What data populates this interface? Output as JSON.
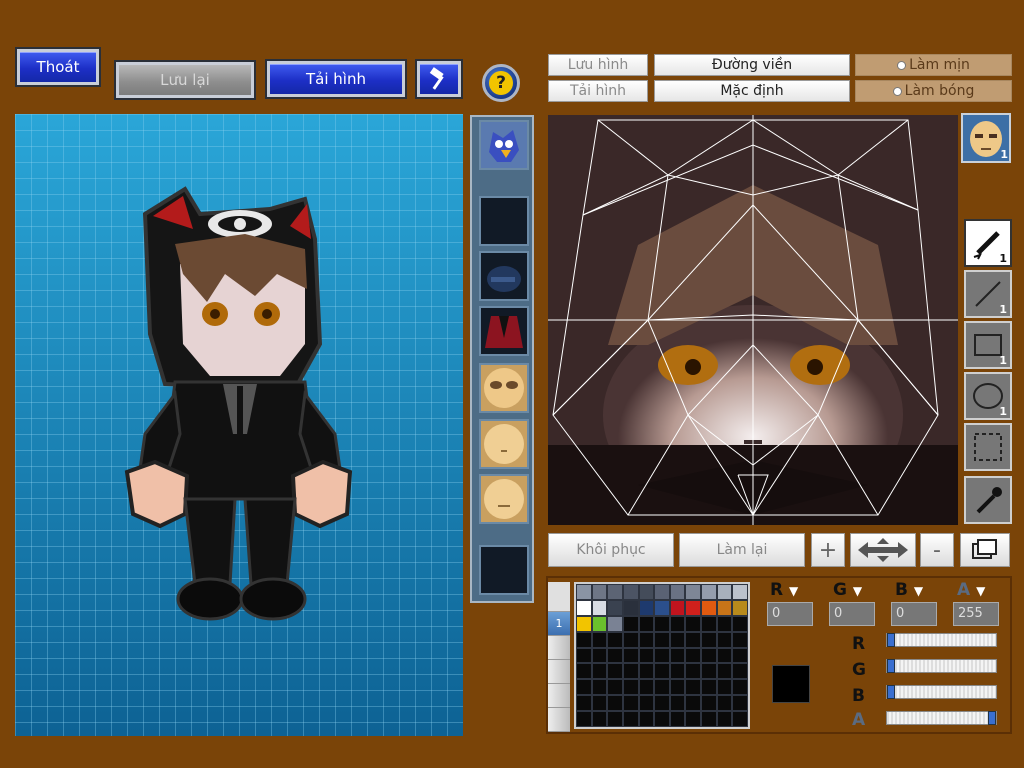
{
  "top_buttons": {
    "exit": "Thoát",
    "save": "Lưu lại",
    "load": "Tải hình"
  },
  "help_icon": "question-icon",
  "right_top": {
    "save_image": "Lưu hình",
    "load_image": "Tải hình",
    "outline": "Đường viền",
    "default": "Mặc định",
    "smooth": "Làm mịn",
    "shade": "Làm bóng"
  },
  "tools": [
    {
      "name": "pen-icon",
      "count": "1"
    },
    {
      "name": "line-icon",
      "count": "1"
    },
    {
      "name": "rect-icon",
      "count": "1"
    },
    {
      "name": "ellipse-icon",
      "count": "1"
    },
    {
      "name": "select-icon",
      "count": ""
    },
    {
      "name": "eyedropper-icon",
      "count": ""
    }
  ],
  "face_thumb_count": "1",
  "bottom_toolbar": {
    "restore": "Khôi phục",
    "redo": "Làm lại"
  },
  "palette_tab": "1",
  "channels": {
    "r_label": "R",
    "g_label": "G",
    "b_label": "B",
    "a_label": "A",
    "r": "0",
    "g": "0",
    "b": "0",
    "a": "255"
  },
  "palette_colors": [
    "#8a94a4",
    "#6e7686",
    "#5c6474",
    "#4c5464",
    "#444c5a",
    "#5a6274",
    "#6a7284",
    "#7e8696",
    "#949cac",
    "#a8b0bc",
    "#bcc2cc",
    "#ffffff",
    "#d8dce4",
    "#3a4250",
    "#2a303c",
    "#1e3a6e",
    "#2b4f8c",
    "#c0141e",
    "#d0201c",
    "#e05a10",
    "#c87418",
    "#b88a1c",
    "#f2c400",
    "#6ac02c",
    "#7a8294"
  ],
  "sliders": {
    "r": 0,
    "g": 0,
    "b": 0,
    "a": 255
  },
  "selected_color": "#000000"
}
